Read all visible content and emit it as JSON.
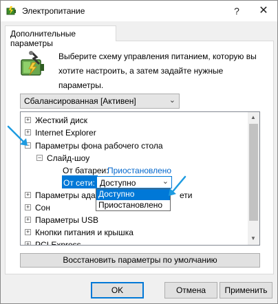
{
  "window": {
    "title": "Электропитание",
    "help_label": "?",
    "close_label": "✕"
  },
  "tab": {
    "label": "Дополнительные параметры"
  },
  "description": "Выберите схему управления питанием, которую вы хотите настроить, а затем задайте нужные параметры.",
  "plan_select": {
    "value": "Сбалансированная [Активен]"
  },
  "tree": {
    "items": [
      {
        "label": "Жесткий диск",
        "state": "collapsed"
      },
      {
        "label": "Internet Explorer",
        "state": "collapsed"
      },
      {
        "label": "Параметры фона рабочего стола",
        "state": "expanded"
      },
      {
        "label": "Слайд-шоу",
        "state": "expanded"
      },
      {
        "label": "От батареи:",
        "value": "Приостановлено"
      },
      {
        "label": "От сети:",
        "value": "Доступно"
      },
      {
        "label": "Параметры ада",
        "suffix": "ети",
        "state": "collapsed"
      },
      {
        "label": "Сон",
        "state": "collapsed"
      },
      {
        "label": "Параметры USB",
        "state": "collapsed"
      },
      {
        "label": "Кнопки питания и крышка",
        "state": "collapsed"
      },
      {
        "label": "PCI Express",
        "state": "collapsed"
      }
    ],
    "expand_symbol": "+",
    "collapse_symbol": "−"
  },
  "dropdown": {
    "options": [
      "Доступно",
      "Приостановлено"
    ],
    "highlighted": "Доступно"
  },
  "restore_button": "Восстановить параметры по умолчанию",
  "buttons": {
    "ok": "OK",
    "cancel": "Отмена",
    "apply": "Применить"
  },
  "colors": {
    "accent": "#0078d7",
    "link": "#0066cc",
    "annotation_arrow": "#1e9be0"
  },
  "icons": {
    "app": "power-battery-icon",
    "desc": "battery-settings-icon",
    "dropdown_arrow": "chevron-down-icon"
  }
}
